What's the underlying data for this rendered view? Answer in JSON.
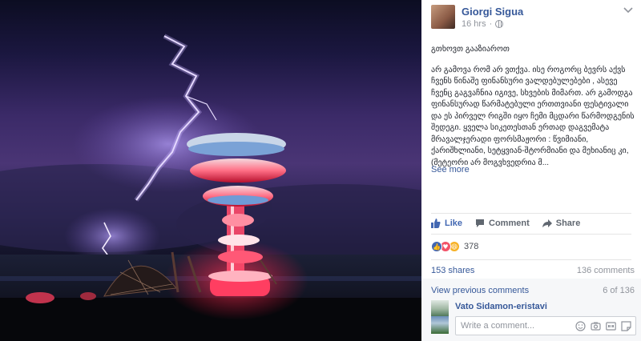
{
  "post": {
    "author": "Giorgi Sigua",
    "time": "16 hrs",
    "privacy_icon": "globe-icon",
    "title": "გთხოვთ გააზიაროთ",
    "body": "არ გამოვა რომ არ ვთქვა. ისე როგორც ბევრს აქვს ჩვენს წინაშე ფინანსური ვალდებულებები , ასევე ჩვენც გაგვაჩნია იგივე, სხვების მიმართ. არ გამოდგა ფინანსურად წარმატებული ერთთვიანი ფესტივალი და ეს პირველ რიგში იყო ჩემი მცდარი წარმოდგენის შედეგი. ყველა სიკეთესთან ერთად დაგვემატა მრავალჯერადი ფორსმაჟორი : წვიმიანი, ქარიშხლიანი, სეტყვიან-შტორმიანი და მეხიანიც კი, (მეტეორი არ მოგვხვედრია მ...",
    "see_more": "See more"
  },
  "actions": {
    "like": "Like",
    "comment": "Comment",
    "share": "Share"
  },
  "reactions": {
    "count": "378",
    "types": [
      "like",
      "love",
      "haha"
    ]
  },
  "stats": {
    "shares": "153 shares",
    "comments": "136 comments"
  },
  "comments": {
    "view_previous": "View previous comments",
    "counter": "6 of 136",
    "latest_author": "Vato Sidamon-eristavi",
    "write_placeholder": "Write a comment...",
    "input_icons": [
      "emoji-icon",
      "camera-icon",
      "gif-icon",
      "sticker-icon"
    ]
  },
  "colors": {
    "link": "#365899",
    "like_blue": "#4267b2",
    "text": "#1d2129",
    "muted": "#90949c"
  }
}
